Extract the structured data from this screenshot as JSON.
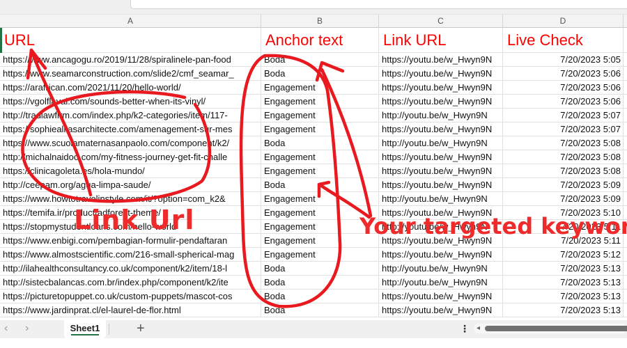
{
  "spreadsheet": {
    "column_letters": [
      "A",
      "B",
      "C",
      "D"
    ],
    "headers": [
      "URL",
      "Anchor text",
      "Link URL",
      "Live Check"
    ],
    "rows": [
      [
        "https://www.ancagogu.ro/2019/11/28/spiralinele-pan-food",
        "Boda",
        "https://youtu.be/w_Hwyn9N",
        "7/20/2023 5:05"
      ],
      [
        "https://www.seamarconstruction.com/slide2/cmf_seamar_",
        "Boda",
        "https://youtu.be/w_Hwyn9N",
        "7/20/2023 5:06"
      ],
      [
        "https://arafrican.com/2021/11/20/hello-world/",
        "Engagement",
        "https://youtu.be/w_Hwyn9N",
        "7/20/2023 5:06"
      ],
      [
        "https://vgolflaval.com/sounds-better-when-its-vinyl/",
        "Engagement",
        "https://youtu.be/w_Hwyn9N",
        "7/20/2023 5:06"
      ],
      [
        "http://tradlawfirm.com/index.php/k2-categories/item/117-",
        "Engagement",
        "http://youtu.be/w_Hwyn9N",
        "7/20/2023 5:07"
      ],
      [
        "https://sophiealliasarchitecte.com/amenagement-sur-mes",
        "Engagement",
        "https://youtu.be/w_Hwyn9N",
        "7/20/2023 5:07"
      ],
      [
        "https://www.scuolamaternasanpaolo.com/component/k2/",
        "Boda",
        "http://youtu.be/w_Hwyn9N",
        "7/20/2023 5:08"
      ],
      [
        "http://michalnaidoo.com/my-fitness-journey-get-fit-challe",
        "Engagement",
        "https://youtu.be/w_Hwyn9N",
        "7/20/2023 5:08"
      ],
      [
        "https://clinicagoleta.es/hola-mundo/",
        "Engagement",
        "https://youtu.be/w_Hwyn9N",
        "7/20/2023 5:08"
      ],
      [
        "http://ceepam.org/agua-limpa-saude/",
        "Boda",
        "https://youtu.be/w_Hwyn9N",
        "7/20/2023 5:09"
      ],
      [
        "https://www.howtotravelinstyle.com/it/?option=com_k2&",
        "Engagement",
        "http://youtu.be/w_Hwyn9N",
        "7/20/2023 5:09"
      ],
      [
        "https://temifa.ir/product/adforest-theme/",
        "Engagement",
        "https://youtu.be/w_Hwyn9N",
        "7/20/2023 5:10"
      ],
      [
        "https://stopmystudentloans.com/hello-world",
        "Engagement",
        "http://youtu.be/w_Hwyn9N",
        "7/20/2023 5:11"
      ],
      [
        "https://www.enbigi.com/pembagian-formulir-pendaftaran",
        "Engagement",
        "https://youtu.be/w_Hwyn9N",
        "7/20/2023 5:11"
      ],
      [
        "https://www.almostscientific.com/216-small-spherical-mag",
        "Engagement",
        "https://youtu.be/w_Hwyn9N",
        "7/20/2023 5:12"
      ],
      [
        "http://ilahealthconsultancy.co.uk/component/k2/item/18-l",
        "Boda",
        "http://youtu.be/w_Hwyn9N",
        "7/20/2023 5:13"
      ],
      [
        "http://sistecbalancas.com.br/index.php/component/k2/ite",
        "Boda",
        "http://youtu.be/w_Hwyn9N",
        "7/20/2023 5:13"
      ],
      [
        "https://picturetopuppet.co.uk/custom-puppets/mascot-cos",
        "Boda",
        "https://youtu.be/w_Hwyn9N",
        "7/20/2023 5:13"
      ],
      [
        "https://www.jardinprat.cl/el-laurel-de-flor.html",
        "Boda",
        "https://youtu.be/w_Hwyn9N",
        "7/20/2023 5:13"
      ]
    ]
  },
  "sheet_bar": {
    "prev_icon": "‹",
    "next_icon": "›",
    "active_sheet": "Sheet1",
    "add_sheet_icon": "+",
    "more_icon": "⋮",
    "scroll_left_icon": "◂"
  },
  "annotations": {
    "link_url_label": "Link Url",
    "keyword_label": "Your targeted keyword",
    "color": "#ee2a2a"
  }
}
